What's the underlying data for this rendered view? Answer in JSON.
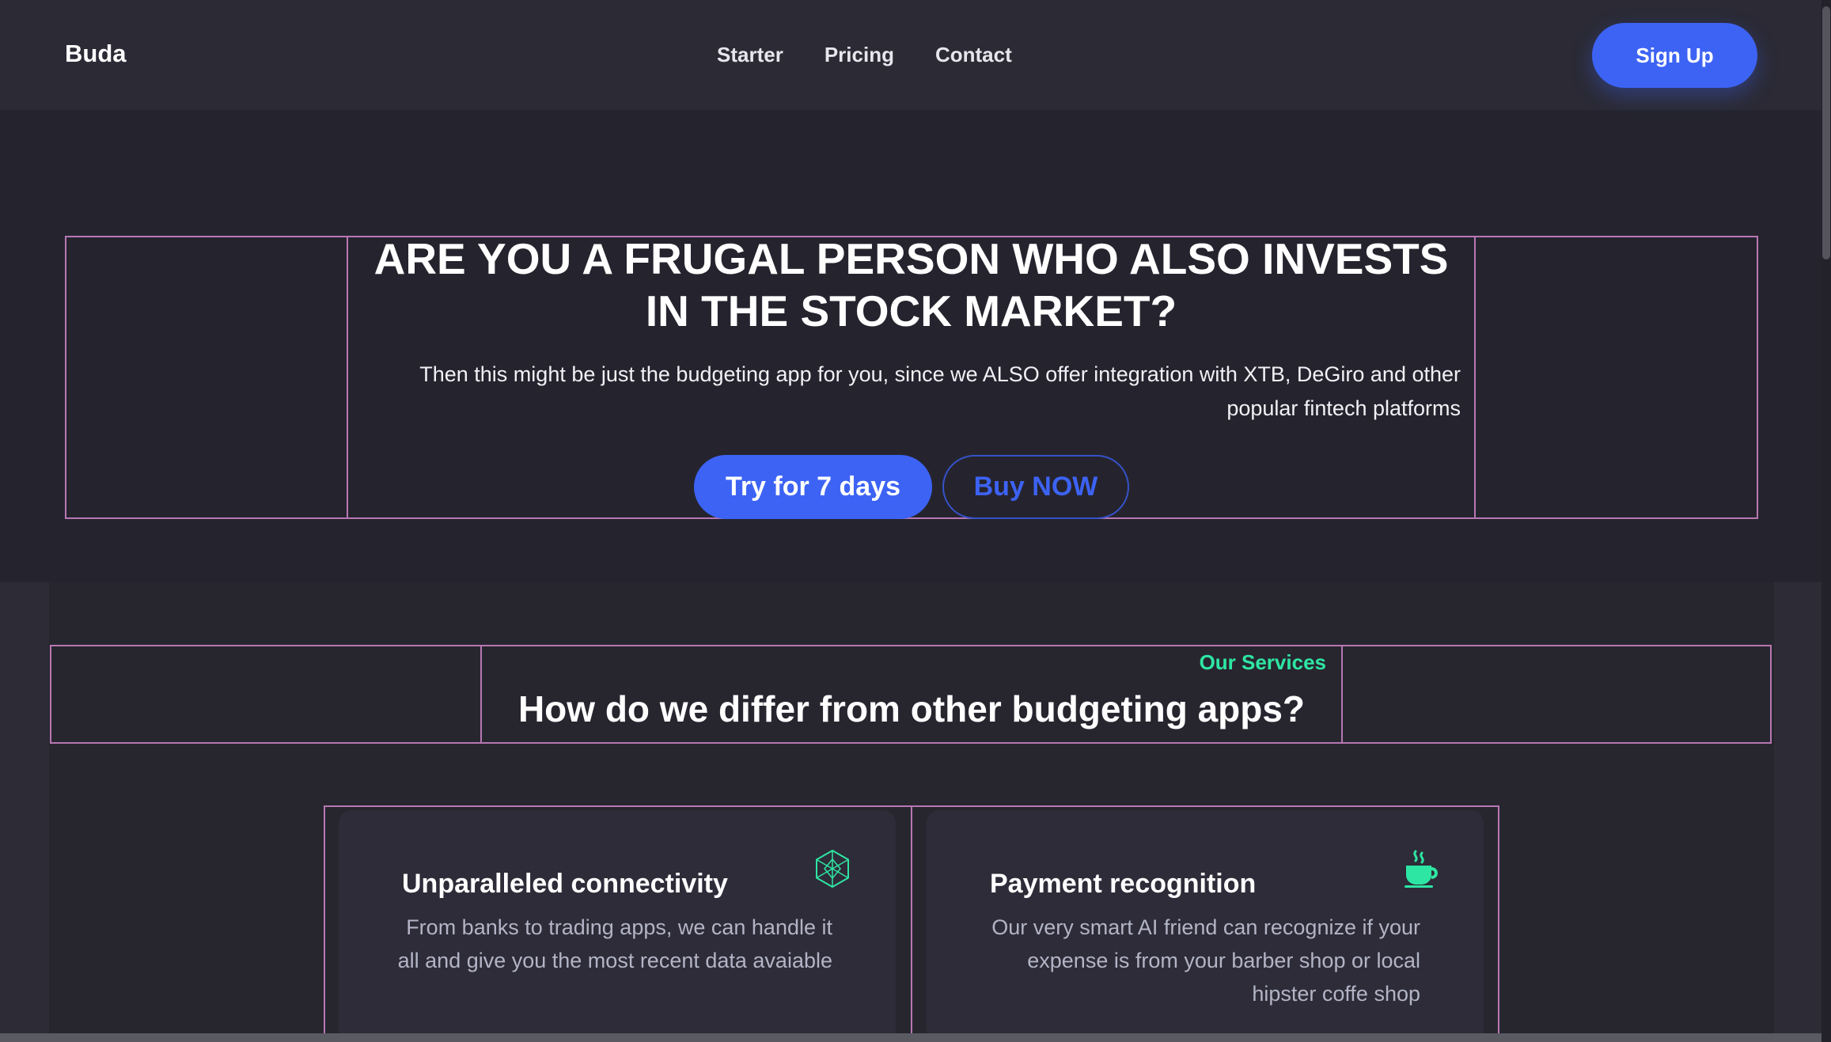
{
  "navbar": {
    "brand": "Buda",
    "links": [
      "Starter",
      "Pricing",
      "Contact"
    ],
    "signup_label": "Sign Up"
  },
  "hero": {
    "title": "ARE YOU A FRUGAL PERSON WHO ALSO INVESTS IN THE STOCK MARKET?",
    "text": "Then this might be just the budgeting app for you, since we ALSO offer integration with XTB, DeGiro and other popular fintech platforms",
    "try_label": "Try for 7 days",
    "buy_label": "Buy NOW"
  },
  "services": {
    "label": "Our Services",
    "title": "How do we differ from other budgeting apps?",
    "cards": [
      {
        "title": "Unparalleled connectivity",
        "text": "From banks to trading apps, we can handle it all and give you the most recent data avaiable",
        "icon": "network-hexagon-icon"
      },
      {
        "title": "Payment recognition",
        "text": "Our very smart AI friend can recognize if your expense is from your barber shop or local hipster coffe shop",
        "icon": "coffee-cup-icon"
      }
    ]
  },
  "colors": {
    "background": "#25242e",
    "navbar": "#2b2a35",
    "accent_blue": "#3d63f5",
    "accent_green": "#2ee6a3",
    "outline_pink": "#b877b3",
    "card": "#2d2c38"
  }
}
